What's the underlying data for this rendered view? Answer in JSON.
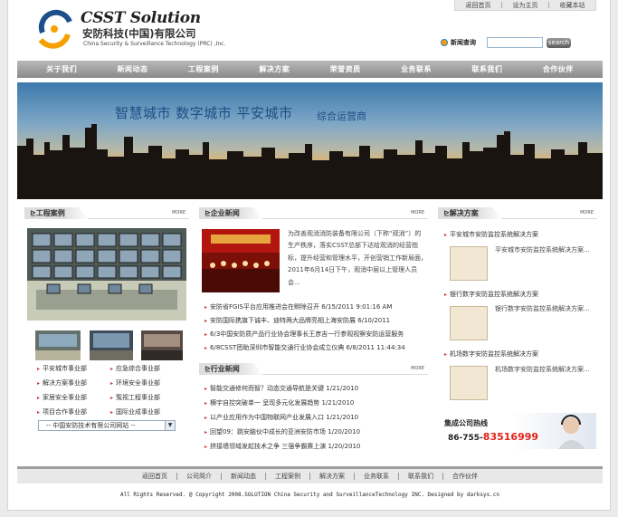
{
  "header": {
    "logo_main": "CSST Solution",
    "logo_cn": "安防科技(中国)有限公司",
    "logo_en": "China Security & Surveillance Technology (PRC) ,Inc.",
    "top_links": [
      "返回首页",
      "设为主页",
      "收藏本站"
    ],
    "search_label": "新闻查询",
    "search_value": "",
    "search_button": "search"
  },
  "nav": [
    "关于我们",
    "新闻动态",
    "工程案例",
    "解决方案",
    "荣誉资质",
    "业务联系",
    "联系我们",
    "合作伙伴"
  ],
  "banner": {
    "headline": "智慧城市  数字城市  平安城市",
    "subline": "综合运营商"
  },
  "more_label": "MORE",
  "cases": {
    "title": "工程案例",
    "menu": [
      [
        "平安城市事业部",
        "应急综合事业部"
      ],
      [
        "解决方案事业部",
        "环境安全事业部"
      ],
      [
        "家居安全事业部",
        "冤视工程事业部"
      ],
      [
        "项目合作事业部",
        "国际业成事业部"
      ]
    ],
    "select_value": "-- 中国安防技术有限公司网站 --"
  },
  "news": {
    "title": "企业新闻",
    "feature_text": "为改善观消消防装备有限公司（下称“观消”）的生产秩序，落实CSST总部下达给观消的经营指标，提升经营和管理水平，开创营销工作新局面，2011年6月14日下午，观消中层以上管理人员会...",
    "items": [
      "安防省FGIS平台应用推进会在孵除召开 6/15/2011 9:01:16 AM",
      "安防国际携旗下诚丰、迪特两大品牌亮相上海安防展 6/10/2011",
      "6/3中国安防质产品行业协会理事长王彦吉一行参观视察安防运营服务",
      "6/8CSST团助深圳市智能交通行业协会成立仪典 6/8/2011 11:44:34"
    ]
  },
  "industry": {
    "title": "行业新闻",
    "items": [
      "智能交通修何而智？动态交通导航是关键 1/21/2010",
      "横宇自控突破单一 呈现多元化发展趋势 1/21/2010",
      "以产业应用作为中国物联网产业发展入口 1/21/2010",
      "回望09：跳安脑伙中成长的亚洲安防市场 1/20/2010",
      "拼接墙领域发起技术之争 三强争霸赛上演 1/20/2010"
    ]
  },
  "solutions": {
    "title": "解决方案",
    "items": [
      {
        "name": "平安城市安防监控系统解决方案",
        "desc": "平安城市安防监控系统解决方案..."
      },
      {
        "name": "银行数字安防监控系统解决方案",
        "desc": "银行数字安防监控系统解决方案..."
      },
      {
        "name": "机场数字安防监控系统解决方案",
        "desc": "机场数字安防监控系统解决方案..."
      }
    ]
  },
  "hotline": {
    "title": "集成公司热线",
    "prefix": "86-755-",
    "number": "83516999"
  },
  "footer": {
    "links": [
      "返回首页",
      "公司简介",
      "新闻动态",
      "工程案例",
      "解决方案",
      "业务联系",
      "联系我们",
      "合作伙伴"
    ],
    "copyright": "All Rights Reserved. @ Copyright 2008.SOLUTION China Security and SurveillanceTechnology INC.   Designed by darksys.cn"
  },
  "colors": {
    "accent_orange": "#f5a000",
    "logo_blue": "#1f4f8a",
    "hotline_red": "#e2231a",
    "nav_gray": "#8a8a8a"
  }
}
